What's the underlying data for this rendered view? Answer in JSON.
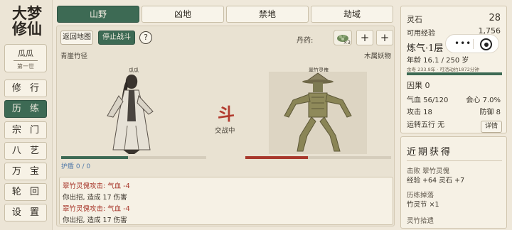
{
  "sidebar": {
    "logo": "大梦修仙",
    "character": {
      "name": "瓜瓜",
      "generation": "第一世"
    },
    "nav": [
      "修 行",
      "历 练",
      "宗 门",
      "八 艺",
      "万 宝",
      "轮 回",
      "设 置"
    ],
    "active_index": 1
  },
  "tabs": [
    "山野",
    "凶地",
    "禁地",
    "劫域"
  ],
  "toolbar": {
    "back": "返回地图",
    "stop": "停止战斗",
    "help": "?",
    "pill_label": "丹药:",
    "pill_count": "×3",
    "plus": "+"
  },
  "battle": {
    "location": "青崖竹径",
    "enemy_type": "木属妖物",
    "player_name": "瓜瓜",
    "enemy_name": "翠竹灵傀",
    "shield_text": "护盾 0 / 0",
    "dou": "斗",
    "state": "交战中",
    "player_hp_fraction": 0.46,
    "enemy_hp_fraction": 0.43
  },
  "log": [
    {
      "text": "翠竹灵傀攻击: 气血 -4",
      "type": "enemy"
    },
    {
      "text": "你出招, 造成 17 伤害",
      "type": "player"
    },
    {
      "text": "翠竹灵傀攻击: 气血 -4",
      "type": "enemy"
    },
    {
      "text": "你出招, 造成 17 伤害",
      "type": "player"
    }
  ],
  "stats": {
    "lingshi_label": "灵石",
    "lingshi": "28",
    "exp_label": "可用经验",
    "exp": "1,756",
    "realm": "炼气·1层",
    "age": "年龄 16.1 / 250 岁",
    "remaining": "余寿 233.9年 · 可活动约1872分钟",
    "yinguo": "因果 0",
    "qixue": "气血 56/120",
    "huixin": "会心 7.0%",
    "gongji": "攻击 18",
    "fangyu": "防御 8",
    "wuxing": "运转五行 无",
    "detail": "详情"
  },
  "recent": {
    "title": "近期获得",
    "items": [
      {
        "head": "击败 翠竹灵傀",
        "detail": "经验 +64 灵石 +7"
      },
      {
        "head": "历练掉落",
        "detail": "竹灵节 ×1"
      }
    ],
    "partial": "灵竹拾遗"
  },
  "colors": {
    "accent": "#3d6a54",
    "enemy_red": "#a8382c",
    "hp_green": "#3d6a54",
    "hp_red": "#a8382c",
    "shield_blue": "#4f78a8"
  }
}
